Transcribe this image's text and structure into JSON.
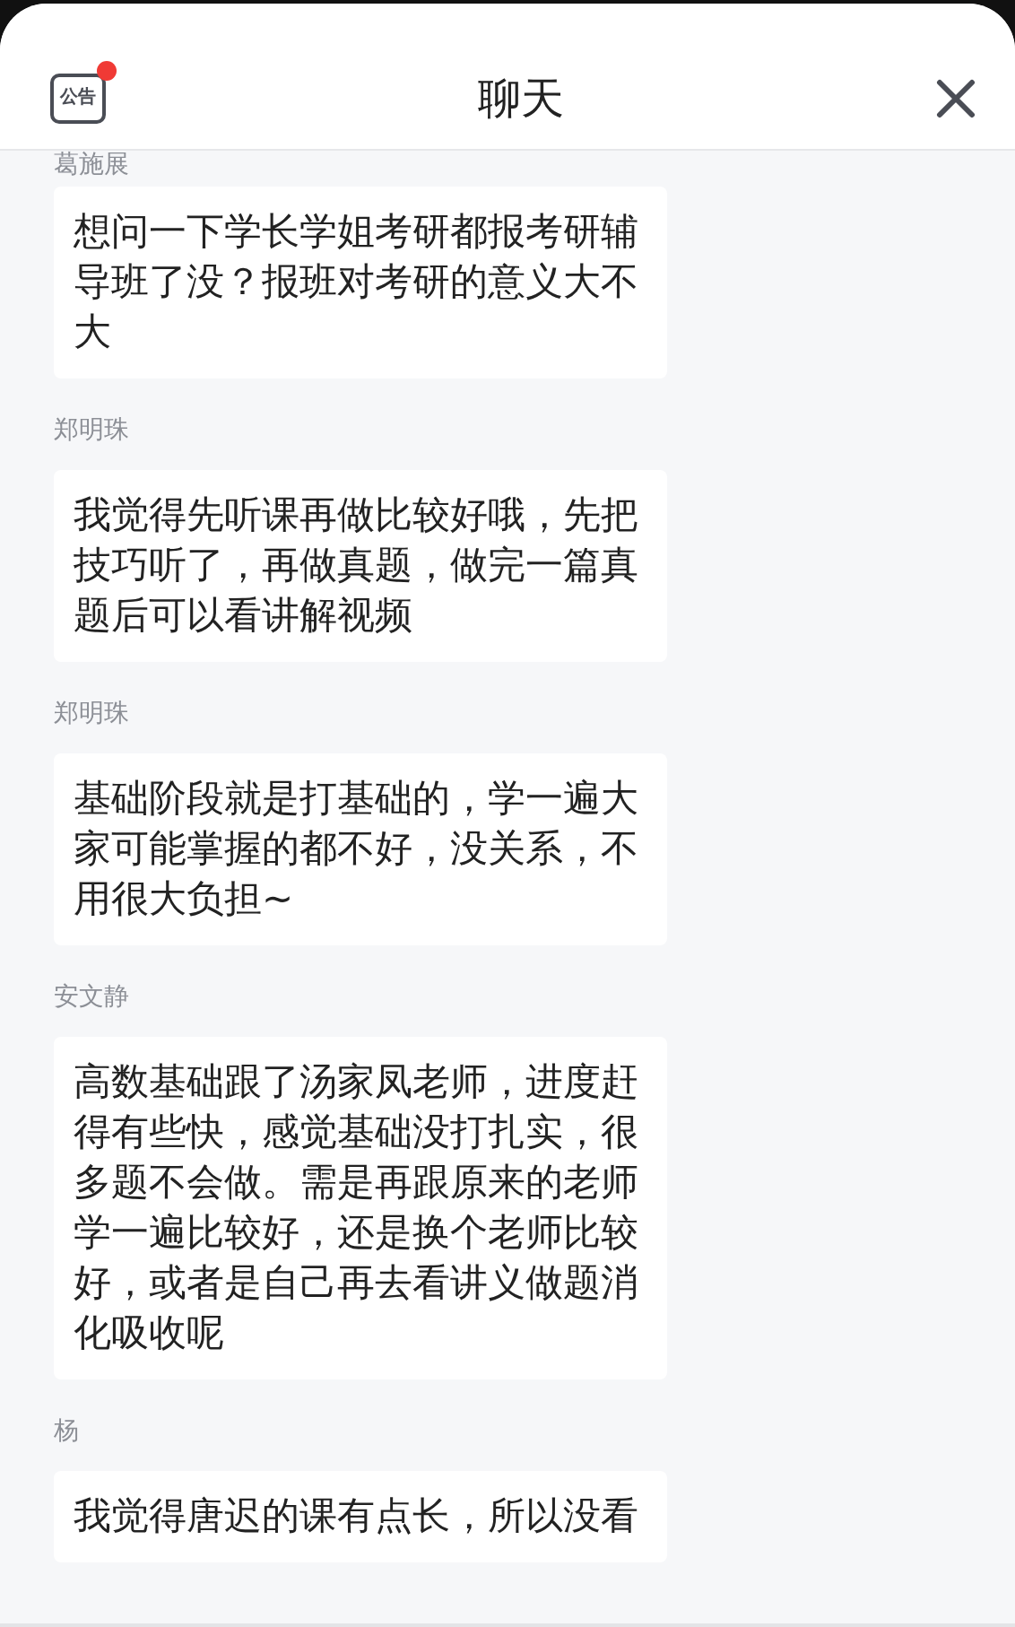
{
  "header": {
    "notice_label": "公告",
    "notice_unread": true,
    "title": "聊天"
  },
  "messages": [
    {
      "sender": "葛施展",
      "text": "想问一下学长学姐考研都报考研辅导班了没？报班对考研的意义大不大"
    },
    {
      "sender": "郑明珠",
      "text": "我觉得先听课再做比较好哦，先把技巧听了，再做真题，做完一篇真题后可以看讲解视频"
    },
    {
      "sender": "郑明珠",
      "text": "基础阶段就是打基础的，学一遍大家可能掌握的都不好，没关系，不用很大负担~"
    },
    {
      "sender": "安文静",
      "text": "高数基础跟了汤家凤老师，进度赶得有些快，感觉基础没打扎实，很多题不会做。需是再跟原来的老师学一遍比较好，还是换个老师比较好，或者是自己再去看讲义做题消化吸收呢"
    },
    {
      "sender": "杨",
      "text": "我觉得唐迟的课有点长，所以没看"
    }
  ]
}
